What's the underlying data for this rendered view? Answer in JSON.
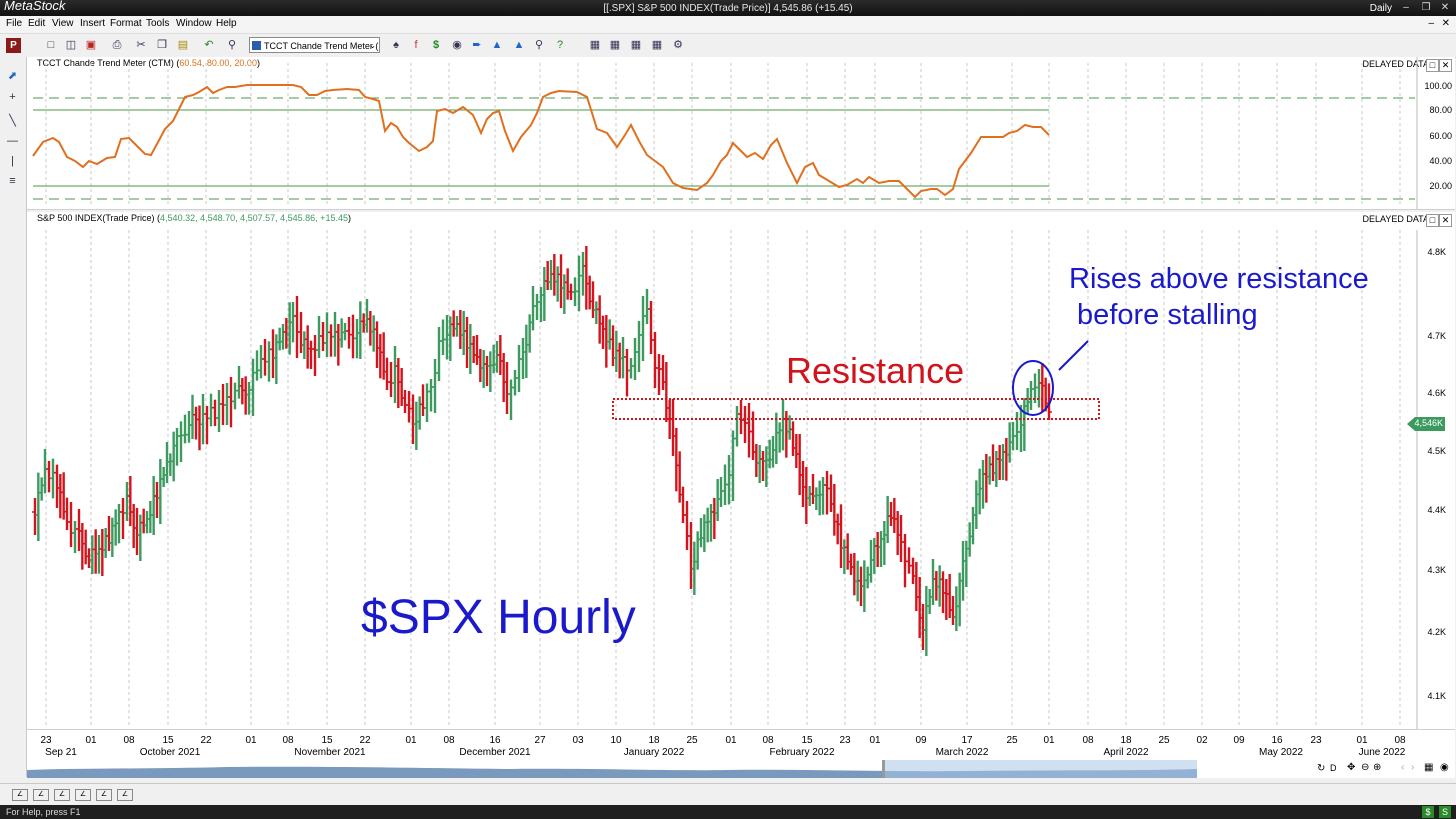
{
  "window": {
    "app_name": "MetaStock",
    "title": "[[.SPX] S&P 500 INDEX(Trade Price)]   4,545.86 (+15.45)",
    "periodicity": "Daily",
    "min_icon": "minimize-icon",
    "max_icon": "maximize-icon",
    "close_icon": "close-icon"
  },
  "menu": [
    "File",
    "Edit",
    "View",
    "Insert",
    "Format",
    "Tools",
    "Window",
    "Help"
  ],
  "toolbar": {
    "indicator_select": "TCCT Chande Trend Meter (",
    "icons": [
      "new-chart-icon",
      "open-icon",
      "save-icon",
      "print-icon",
      "cut-icon",
      "copy-icon",
      "paste-icon",
      "undo-icon",
      "zoom-icon",
      "explorer-icon",
      "formula-icon",
      "dollar-icon",
      "binoculars-icon",
      "forward-icon",
      "expert-icon",
      "system-tester-icon",
      "help-icon",
      "layout1-icon",
      "layout2-icon",
      "layout3-icon",
      "layout4-icon",
      "settings-icon"
    ]
  },
  "left_tools": [
    "pointer-icon",
    "crosshair-icon",
    "trendline-icon",
    "horizontal-line-icon",
    "vertical-line-icon",
    "fibonacci-icon"
  ],
  "indicator_pane": {
    "title_prefix": "TCCT Chande Trend Meter (CTM) (",
    "title_values": "60.54, 80.00, 20.00",
    "title_suffix": ")",
    "delayed_label": "DELAYED DATA",
    "y_labels": [
      "100.00",
      "80.00",
      "60.00",
      "40.00",
      "20.00"
    ],
    "line_color": "#e07020"
  },
  "price_pane": {
    "title_prefix": "S&P 500 INDEX(Trade Price) (",
    "title_values": "4,540.32, 4,548.70, 4,507.57, 4,545.86, +15.45",
    "title_suffix": ")",
    "delayed_label": "DELAYED DATA",
    "y_labels": [
      "4.8K",
      "4.7K",
      "4.6K",
      "4.5K",
      "4.4K",
      "4.3K",
      "4.2K",
      "4.1K"
    ],
    "last_price_tag": "4,546K",
    "up_color": "#3c9a5f",
    "down_color": "#d4141c",
    "annotations": {
      "resistance": "Resistance",
      "rises_line1": "Rises above resistance",
      "rises_line2": " before stalling",
      "hourly": "$SPX Hourly"
    },
    "annotation_colors": {
      "resistance": "#d0141c",
      "blue": "#1a1acc"
    }
  },
  "x_axis": {
    "ticks": [
      "23",
      "01",
      "08",
      "15",
      "22",
      "01",
      "08",
      "15",
      "22",
      "01",
      "08",
      "16",
      "27",
      "03",
      "10",
      "18",
      "25",
      "01",
      "08",
      "15",
      "23",
      "01",
      "09",
      "17",
      "25",
      "01",
      "08",
      "18",
      "25",
      "02",
      "09",
      "16",
      "23",
      "01",
      "08"
    ],
    "months": [
      "Sep 21",
      "October 2021",
      "November 2021",
      "December 2021",
      "January 2022",
      "February 2022",
      "March 2022",
      "April 2022",
      "May 2022",
      "June 2022"
    ]
  },
  "navigator": {
    "period_label": "D"
  },
  "status": {
    "help_text": "For Help, press F1"
  }
}
